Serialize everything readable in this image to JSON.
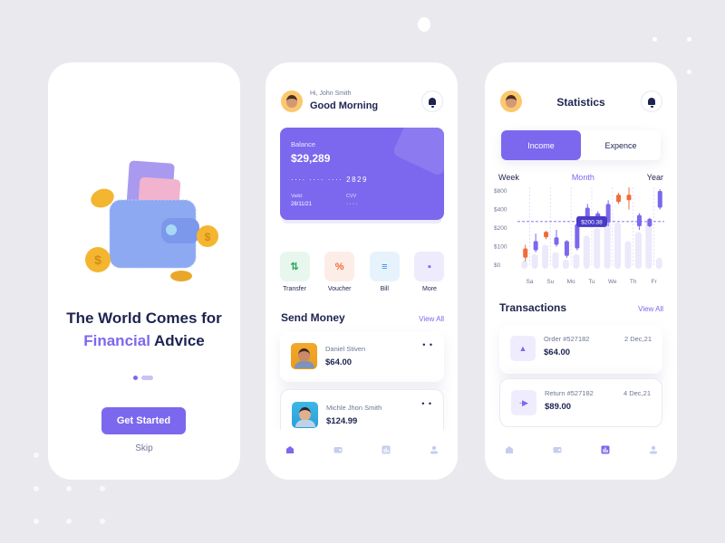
{
  "onboarding": {
    "title_line1": "The World Comes for",
    "title_accent": "Financial",
    "title_rest": " Advice",
    "page_indicator": {
      "current": 1,
      "total": 2
    },
    "cta_label": "Get Started",
    "skip_label": "Skip"
  },
  "home": {
    "greeting_small": "Hi, John Smith",
    "greeting_big": "Good Morning",
    "card": {
      "balance_label": "Balance",
      "balance": "$29,289",
      "number_masked": "····  ····  ····  2829",
      "valid_label": "Vaild:",
      "valid_value": "28/11/21",
      "cvv_label": "CVV",
      "cvv_value": "····"
    },
    "actions": [
      {
        "label": "Transfer",
        "icon": "transfer-icon",
        "bg": "#E8F7EE",
        "fg": "#2DAA5B",
        "glyph": "⇅"
      },
      {
        "label": "Voucher",
        "icon": "voucher-icon",
        "bg": "#FDEDE7",
        "fg": "#F26B3A",
        "glyph": "%"
      },
      {
        "label": "Bill",
        "icon": "bill-icon",
        "bg": "#E6F3FD",
        "fg": "#2E8BEA",
        "glyph": "≡"
      },
      {
        "label": "More",
        "icon": "grid-icon",
        "bg": "#EEEBFD",
        "fg": "#7B68EE",
        "glyph": "▪"
      }
    ],
    "send_money_title": "Send Money",
    "view_all": "View All",
    "contacts": [
      {
        "name": "Daniel Stiven",
        "amount": "$64.00"
      },
      {
        "name": "Michle Jhon Smith",
        "amount": "$124.99"
      }
    ]
  },
  "stats": {
    "title": "Statistics",
    "tabs": [
      "Income",
      "Expence"
    ],
    "active_tab": "Income",
    "periods": [
      "Week",
      "Month",
      "Year"
    ],
    "active_period": "Month",
    "transactions_title": "Transactions",
    "view_all": "View All",
    "transactions": [
      {
        "label": "Order #527182",
        "date": "2 Dec,21",
        "amount": "$64.00",
        "icon": "upload-icon",
        "glyph": "▲"
      },
      {
        "label": "Return #527182",
        "date": "4 Dec,21",
        "amount": "$89.00",
        "icon": "arrow-right-icon",
        "glyph": "-▶"
      }
    ]
  },
  "chart_data": {
    "type": "candlestick",
    "y_tick_labels": [
      "$0",
      "$100",
      "$200",
      "$400",
      "$800"
    ],
    "x_labels": [
      "Sa",
      "Su",
      "Mo",
      "Tu",
      "We",
      "Th",
      "Fr"
    ],
    "reference_line": {
      "value_label": "$200.38",
      "level": 2.35
    },
    "colors": {
      "up": "#7B68EE",
      "down": "#F26B3A",
      "bars": "#ECE9FB"
    },
    "note": "levels on tick-index scale (0=$0,1=$100,2=$200,3=$400,4=$800)",
    "candles": [
      {
        "dir": "down",
        "low": 0.2,
        "open": 0.9,
        "close": 0.4,
        "high": 1.1
      },
      {
        "dir": "up",
        "low": 0.7,
        "open": 0.8,
        "close": 1.3,
        "high": 1.7
      },
      {
        "dir": "down",
        "low": 1.4,
        "open": 1.8,
        "close": 1.5,
        "high": 1.85
      },
      {
        "dir": "up",
        "low": 1.0,
        "open": 1.1,
        "close": 1.5,
        "high": 1.9
      },
      {
        "dir": "up",
        "low": 0.4,
        "open": 0.5,
        "close": 1.3,
        "high": 1.35
      },
      {
        "dir": "up",
        "low": 0.8,
        "open": 0.9,
        "close": 2.2,
        "high": 2.3
      },
      {
        "dir": "up",
        "low": 2.1,
        "open": 2.2,
        "close": 3.1,
        "high": 3.3
      },
      {
        "dir": "up",
        "low": 2.2,
        "open": 2.3,
        "close": 2.8,
        "high": 2.9
      },
      {
        "dir": "up",
        "low": 2.1,
        "open": 2.3,
        "close": 3.3,
        "high": 3.5
      },
      {
        "dir": "down",
        "low": 3.3,
        "open": 3.8,
        "close": 3.4,
        "high": 3.9
      },
      {
        "dir": "down",
        "low": 3.0,
        "open": 3.8,
        "close": 3.5,
        "high": 4.2
      },
      {
        "dir": "up",
        "low": 1.9,
        "open": 2.1,
        "close": 2.7,
        "high": 2.8
      },
      {
        "dir": "up",
        "low": 2.05,
        "open": 2.1,
        "close": 2.5,
        "high": 2.55
      },
      {
        "dir": "up",
        "low": 3.0,
        "open": 3.1,
        "close": 4.0,
        "high": 4.1
      }
    ],
    "bars": [
      0.25,
      0.6,
      1.1,
      0.7,
      0.3,
      0.6,
      1.6,
      2.0,
      2.6,
      2.3,
      1.3,
      1.8,
      2.4,
      0.4
    ]
  }
}
